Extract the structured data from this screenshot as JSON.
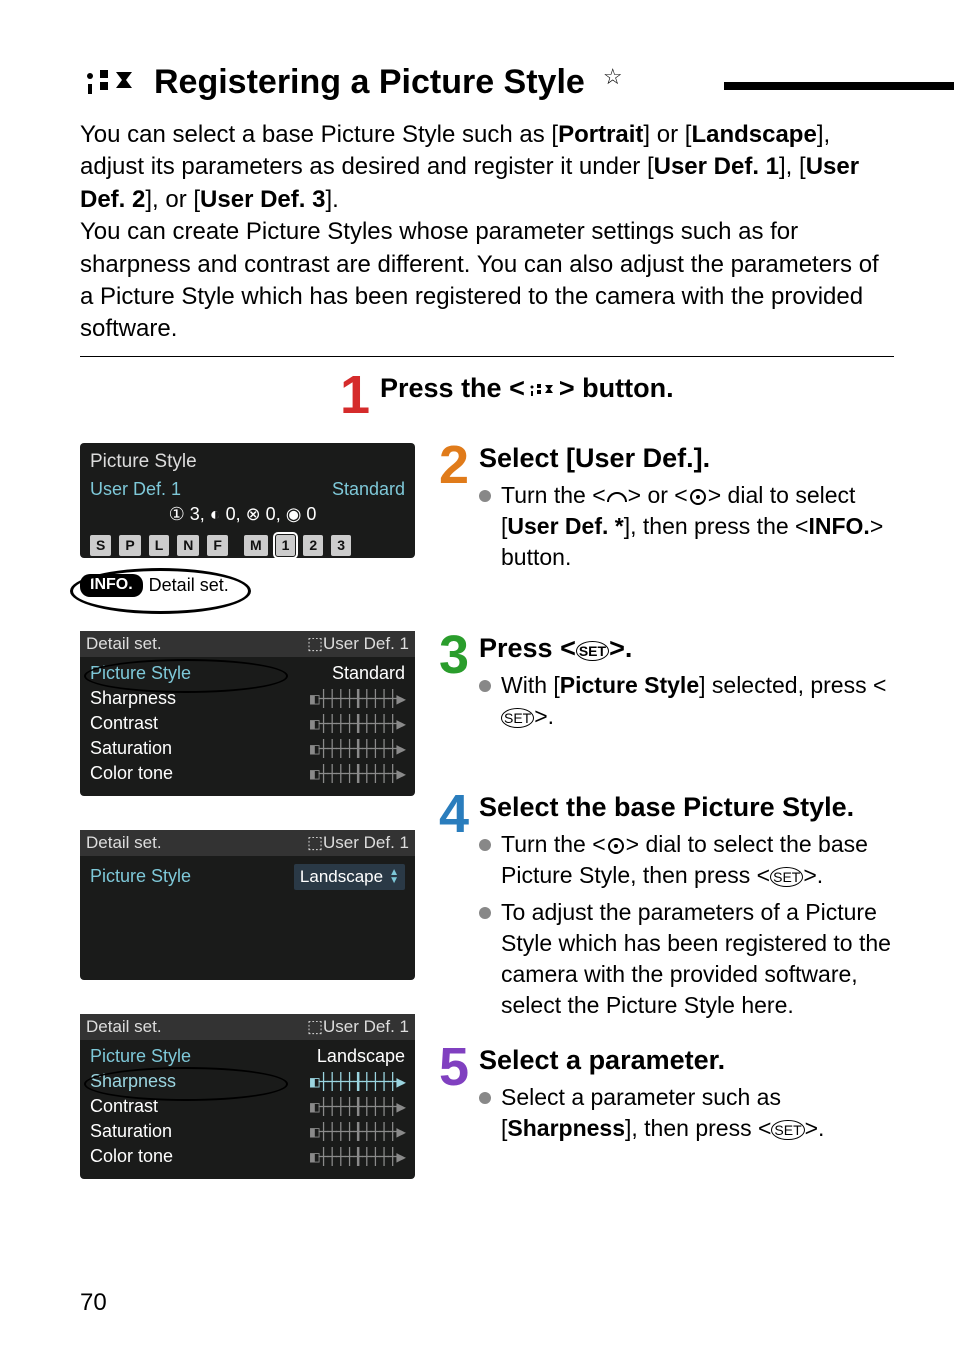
{
  "page_number": "70",
  "title": "Registering a Picture Style",
  "title_star": "☆",
  "intro_html": "You can select a base Picture Style such as [<b>Portrait</b>] or [<b>Landscape</b>], adjust its parameters as desired and register it under [<b>User Def. 1</b>], [<b>User Def. 2</b>], or [<b>User Def. 3</b>].<br>You can create Picture Styles whose parameter settings such as for sharpness and contrast are different. You can also adjust the parameters of a Picture Style which has been registered to the camera with the provided software.",
  "steps": {
    "s1": {
      "head": "Press the <    > button."
    },
    "s2": {
      "head": "Select [User Def.].",
      "bullet1": "Turn the <   > or <   > dial to select [<b>User Def. *</b>], then press the <INFO.> button."
    },
    "s3": {
      "head": "Press <SET>.",
      "bullet1": "With [<b>Picture Style</b>] selected, press <SET>."
    },
    "s4": {
      "head": "Select the base Picture Style.",
      "bullet1": "Turn the <   > dial to select the base Picture Style, then press <SET>.",
      "bullet2": "To adjust the parameters of a Picture Style which has been registered to the camera with the provided software, select the Picture Style here."
    },
    "s5": {
      "head": "Select a parameter.",
      "bullet1": "Select a parameter such as [<b>Sharpness</b>], then press <SET>."
    }
  },
  "camera": {
    "box1": {
      "title": "Picture Style",
      "user": "User Def. 1",
      "user_value": "Standard",
      "params_line": "① 3, ◐ 0, ⊗ 0, ◉ 0",
      "badges": [
        "S",
        "P",
        "L",
        "N",
        "F",
        "M",
        "1",
        "2",
        "3"
      ],
      "selected_badge_index": 6,
      "info_label": "INFO.",
      "info_text": "Detail set."
    },
    "box2": {
      "header_left": "Detail set.",
      "header_right": "User Def. 1",
      "rows": [
        {
          "label": "Picture Style",
          "value": "Standard",
          "hl": true
        },
        {
          "label": "Sharpness",
          "meter": true
        },
        {
          "label": "Contrast",
          "meter": true
        },
        {
          "label": "Saturation",
          "meter": true
        },
        {
          "label": "Color tone",
          "meter": true
        }
      ]
    },
    "box3": {
      "header_left": "Detail set.",
      "header_right": "User Def. 1",
      "row_label": "Picture Style",
      "row_value": "Landscape"
    },
    "box4": {
      "header_left": "Detail set.",
      "header_right": "User Def. 1",
      "rows": [
        {
          "label": "Picture Style",
          "value": "Landscape"
        },
        {
          "label": "Sharpness",
          "meter": true,
          "hl": true
        },
        {
          "label": "Contrast",
          "meter": true
        },
        {
          "label": "Saturation",
          "meter": true
        },
        {
          "label": "Color tone",
          "meter": true
        }
      ]
    }
  }
}
